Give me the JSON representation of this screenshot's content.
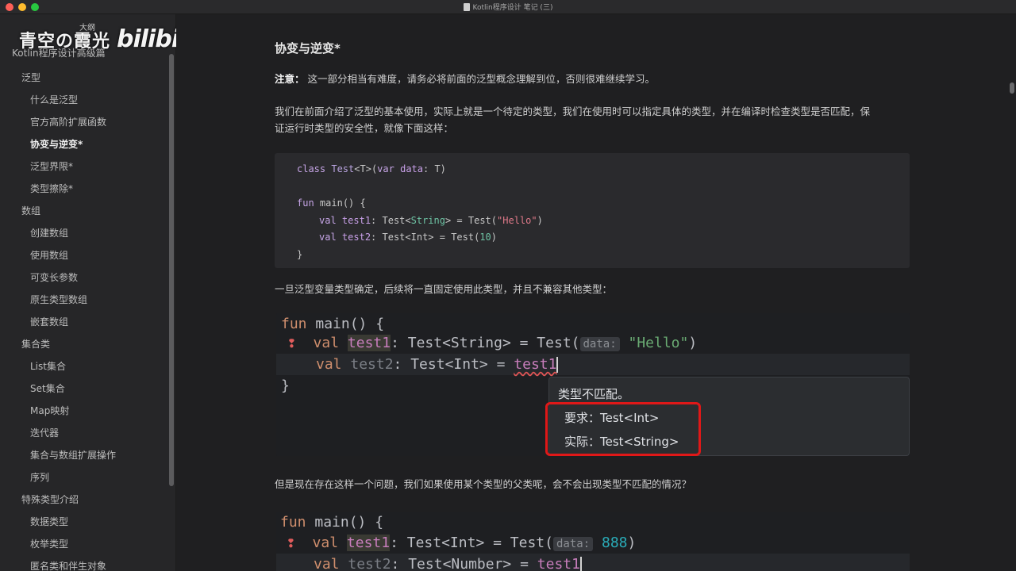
{
  "window": {
    "title": "Kotlin程序设计 笔记 (三)"
  },
  "watermark": {
    "text": "青空の霞光",
    "logo": "bilibili"
  },
  "sidebar": {
    "outline_label": "大纲",
    "top_item": "Kotlin程序设计高级篇",
    "items": [
      {
        "label": "泛型",
        "level": 1
      },
      {
        "label": "什么是泛型",
        "level": 2
      },
      {
        "label": "官方高阶扩展函数",
        "level": 2
      },
      {
        "label": "协变与逆变*",
        "level": 2,
        "active": true
      },
      {
        "label": "泛型界限*",
        "level": 2
      },
      {
        "label": "类型擦除*",
        "level": 2
      },
      {
        "label": "数组",
        "level": 1
      },
      {
        "label": "创建数组",
        "level": 2
      },
      {
        "label": "使用数组",
        "level": 2
      },
      {
        "label": "可变长参数",
        "level": 2
      },
      {
        "label": "原生类型数组",
        "level": 2
      },
      {
        "label": "嵌套数组",
        "level": 2
      },
      {
        "label": "集合类",
        "level": 1
      },
      {
        "label": "List集合",
        "level": 2
      },
      {
        "label": "Set集合",
        "level": 2
      },
      {
        "label": "Map映射",
        "level": 2
      },
      {
        "label": "迭代器",
        "level": 2
      },
      {
        "label": "集合与数组扩展操作",
        "level": 2
      },
      {
        "label": "序列",
        "level": 2
      },
      {
        "label": "特殊类型介绍",
        "level": 1
      },
      {
        "label": "数据类型",
        "level": 2
      },
      {
        "label": "枚举类型",
        "level": 2
      },
      {
        "label": "匿名类和伴生对象",
        "level": 2
      }
    ]
  },
  "article": {
    "heading": "协变与逆变*",
    "note_label": "注意：",
    "note_text": " 这一部分相当有难度，请务必将前面的泛型概念理解到位，否则很难继续学习。",
    "para1_line1": "我们在前面介绍了泛型的基本使用，实际上就是一个待定的类型，我们在使用时可以指定具体的类型，并在编译时检查类型是否匹配，保",
    "para1_line2": "证运行时类型的安全性，就像下面这样：",
    "para2": "一旦泛型变量类型确定，后续将一直固定使用此类型，并且不兼容其他类型：",
    "para3": "但是现在存在这样一个问题，我们如果使用某个类型的父类呢，会不会出现类型不匹配的情况？"
  },
  "code1": {
    "l1_kw": "class",
    "l1_ty": "Test",
    "l1_gen": "<T>(",
    "l1_kw2": "var",
    "l1_name": "data",
    "l1_rest": ": T)",
    "l2_kw": "fun",
    "l2_rest": "main() {",
    "l3_kw": "val",
    "l3_name": "test1",
    "l3_a": ": Test<",
    "l3_type": "String",
    "l3_b": "> = Test(",
    "l3_str": "\"Hello\"",
    "l3_c": ")",
    "l4_kw": "val",
    "l4_name": "test2",
    "l4_a": ": Test<Int> = Test(",
    "l4_num": "10",
    "l4_c": ")",
    "l5": "}"
  },
  "ide1": {
    "l1_kw": "fun",
    "l1_rest": "main() {",
    "l2_kw": "val",
    "l2_name": "test1",
    "l2_a": ": Test<String> = Test(",
    "l2_hint": "data:",
    "l2_str": "\"Hello\"",
    "l2_c": ")",
    "l3_kw": "val",
    "l3_name": "test2",
    "l3_a": ": Test<Int> = ",
    "l3_ref": "test1",
    "l4": "}",
    "tooltip_title": "类型不匹配。",
    "tooltip_required": "要求：Test<Int>",
    "tooltip_actual": "实际：Test<String>"
  },
  "ide2": {
    "l1_kw": "fun",
    "l1_rest": "main() {",
    "l2_kw": "val",
    "l2_name": "test1",
    "l2_a": ": Test<Int> = Test(",
    "l2_hint": "data:",
    "l2_num": "888",
    "l2_c": ")",
    "l3_kw": "val",
    "l3_name": "test2",
    "l3_a": ": Test<Number> = ",
    "l3_ref": "test1"
  }
}
